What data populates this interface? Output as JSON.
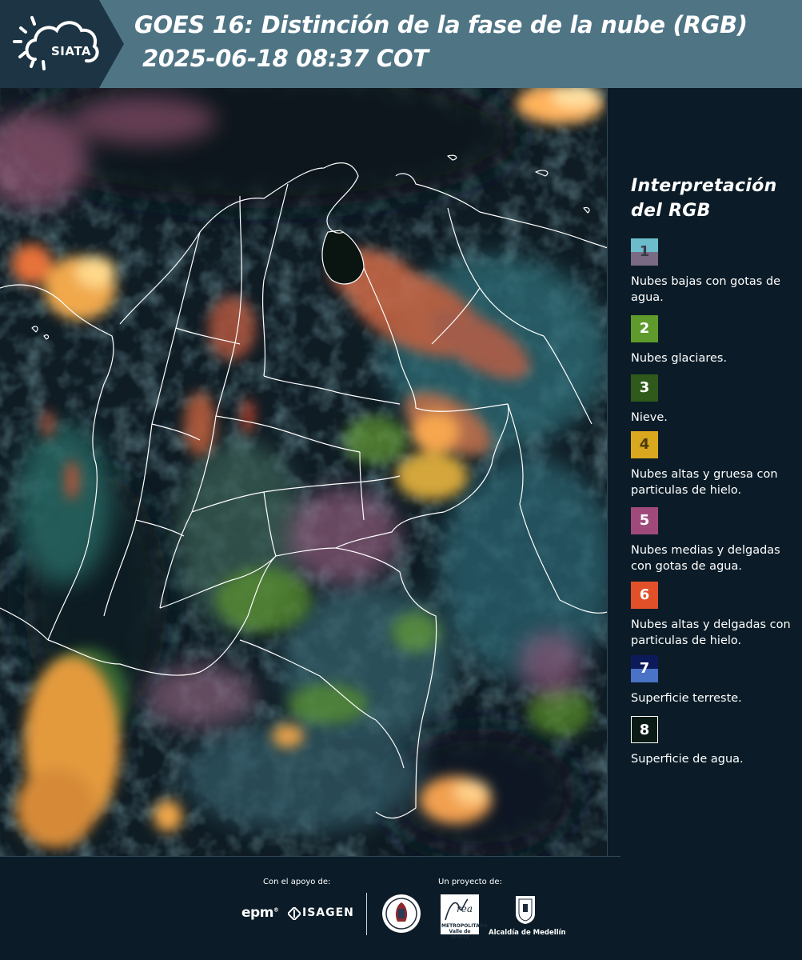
{
  "header": {
    "logo_text": "SIATA",
    "title": "GOES 16: Distinción de la fase de la nube (RGB)",
    "subtitle": "2025-06-18 08:37 COT",
    "colors": {
      "dark_band": "#1c3443",
      "title_band": "#4f7585"
    }
  },
  "legend": {
    "title_line1": "Interpretación",
    "title_line2": "del RGB",
    "items": [
      {
        "number": "1",
        "label": "Nubes bajas con gotas de agua.",
        "color": "#6cbccb/#7a6a84"
      },
      {
        "number": "2",
        "label": "Nubes glaciares.",
        "color": "#5e9a2c"
      },
      {
        "number": "3",
        "label": "Nieve.",
        "color": "#2f5a1c"
      },
      {
        "number": "4",
        "label": "Nubes altas y gruesa con particulas de hielo.",
        "color": "#d9a81e"
      },
      {
        "number": "5",
        "label": "Nubes medias y delgadas con gotas de agua.",
        "color": "#a04a7c"
      },
      {
        "number": "6",
        "label": "Nubes altas y delgadas con particulas de hielo.",
        "color": "#e2502a"
      },
      {
        "number": "7",
        "label": "Superficie terreste.",
        "color": "#0d1a5a/#4a72c6"
      },
      {
        "number": "8",
        "label": "Superficie de agua.",
        "color": "#0b1a14"
      }
    ]
  },
  "footer": {
    "support_label": "Con el apoyo de:",
    "project_label": "Un proyecto de:",
    "sponsor_1": "epm",
    "sponsor_2": "ISAGEN",
    "area_logo_text": "METROPOLITANA Valle de Aburrá",
    "alcaldia": "Alcaldía de Medellín"
  }
}
